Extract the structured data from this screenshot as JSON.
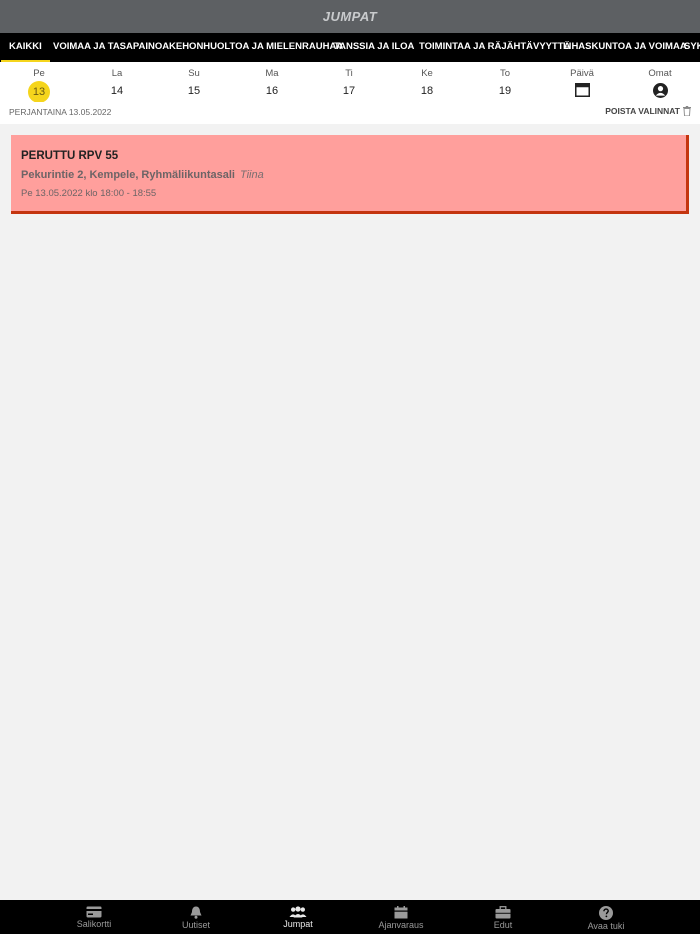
{
  "header": {
    "title": "JUMPAT"
  },
  "categories": [
    {
      "label": "KAIKKI",
      "active": true
    },
    {
      "label": "VOIMAA JA TASAPAINOA"
    },
    {
      "label": "KEHONHUOLTOA JA MIELENRAUHAA"
    },
    {
      "label": "TANSSIA JA ILOA"
    },
    {
      "label": "TOIMINTAA JA RÄJÄHTÄVYYTTÄ"
    },
    {
      "label": "LIHASKUNTOA JA VOIMAA"
    },
    {
      "label": "SYK"
    }
  ],
  "days": [
    {
      "name": "Pe",
      "date": "13",
      "selected": true
    },
    {
      "name": "La",
      "date": "14"
    },
    {
      "name": "Su",
      "date": "15"
    },
    {
      "name": "Ma",
      "date": "16"
    },
    {
      "name": "Ti",
      "date": "17"
    },
    {
      "name": "Ke",
      "date": "18"
    },
    {
      "name": "To",
      "date": "19"
    }
  ],
  "day_picker": {
    "label": "Päivä",
    "icon": "calendar-icon"
  },
  "own_filter": {
    "label": "Omat",
    "icon": "user-icon"
  },
  "selection": {
    "date_text": "PERJANTAINA 13.05.2022",
    "clear_label": "POISTA VALINNAT",
    "clear_icon": "trash-icon"
  },
  "class_card": {
    "title": "PERUTTU RPV 55",
    "location": "Pekurintie 2, Kempele, Ryhmäliikuntasali",
    "instructor": "Tiina",
    "time": "Pe 13.05.2022 klo 18:00 - 18:55",
    "status_color": "#ff9f9c",
    "accent_color": "#c4350f"
  },
  "tabs": [
    {
      "label": "Salikortti",
      "icon": "card-icon"
    },
    {
      "label": "Uutiset",
      "icon": "bell-icon"
    },
    {
      "label": "Jumpat",
      "icon": "group-icon",
      "active": true
    },
    {
      "label": "Ajanvaraus",
      "icon": "calendar-icon"
    },
    {
      "label": "Edut",
      "icon": "briefcase-icon"
    },
    {
      "label": "Avaa tuki",
      "icon": "help-icon"
    }
  ],
  "colors": {
    "accent": "#f5d51c",
    "header_bg": "#5d6063",
    "nav_bg": "#000000"
  }
}
